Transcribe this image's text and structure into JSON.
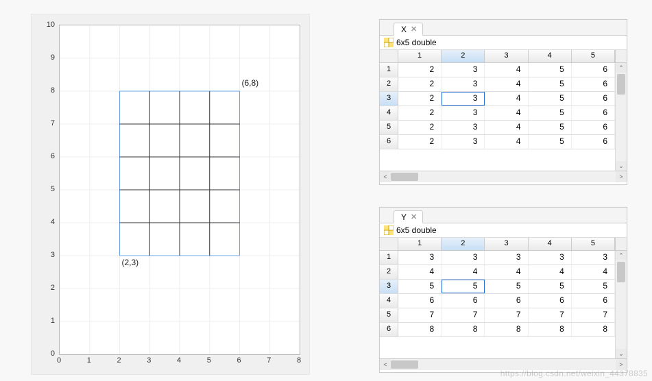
{
  "chart_data": {
    "type": "line",
    "xlim": [
      0,
      8
    ],
    "ylim": [
      0,
      10
    ],
    "xticks": [
      0,
      1,
      2,
      3,
      4,
      5,
      6,
      7,
      8
    ],
    "yticks": [
      0,
      1,
      2,
      3,
      4,
      5,
      6,
      7,
      8,
      9,
      10
    ],
    "mesh": {
      "x_range": [
        2,
        6
      ],
      "y_range": [
        3,
        8
      ],
      "x_lines": [
        2,
        3,
        4,
        5,
        6
      ],
      "y_lines": [
        3,
        4,
        5,
        6,
        7,
        8
      ]
    },
    "annotations": [
      {
        "text": "(2,3)",
        "x": 2,
        "y": 3,
        "pos": "below-right"
      },
      {
        "text": "(6,8)",
        "x": 6,
        "y": 8,
        "pos": "above-right"
      }
    ],
    "title": "",
    "xlabel": "",
    "ylabel": ""
  },
  "var_x": {
    "tab_label": "X",
    "meta_text": "6x5 double",
    "col_headers": [
      "1",
      "2",
      "3",
      "4",
      "5"
    ],
    "row_headers": [
      "1",
      "2",
      "3",
      "4",
      "5",
      "6"
    ],
    "selected_col": 2,
    "selected_row": 3,
    "data": [
      [
        2,
        3,
        4,
        5,
        6
      ],
      [
        2,
        3,
        4,
        5,
        6
      ],
      [
        2,
        3,
        4,
        5,
        6
      ],
      [
        2,
        3,
        4,
        5,
        6
      ],
      [
        2,
        3,
        4,
        5,
        6
      ],
      [
        2,
        3,
        4,
        5,
        6
      ]
    ]
  },
  "var_y": {
    "tab_label": "Y",
    "meta_text": "6x5 double",
    "col_headers": [
      "1",
      "2",
      "3",
      "4",
      "5"
    ],
    "row_headers": [
      "1",
      "2",
      "3",
      "4",
      "5",
      "6"
    ],
    "selected_col": 2,
    "selected_row": 3,
    "data": [
      [
        3,
        3,
        3,
        3,
        3
      ],
      [
        4,
        4,
        4,
        4,
        4
      ],
      [
        5,
        5,
        5,
        5,
        5
      ],
      [
        6,
        6,
        6,
        6,
        6
      ],
      [
        7,
        7,
        7,
        7,
        7
      ],
      [
        8,
        8,
        8,
        8,
        8
      ]
    ]
  },
  "watermark": "https://blog.csdn.net/weixin_44378835"
}
